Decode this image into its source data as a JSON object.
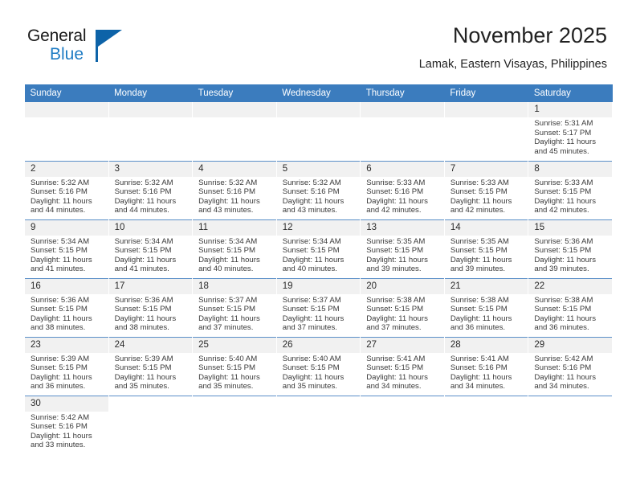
{
  "brand": {
    "name_part1": "General",
    "name_part2": "Blue",
    "accent_color": "#1f7cc4",
    "flag_color": "#0d63a8"
  },
  "header": {
    "month_title": "November 2025",
    "location": "Lamak, Eastern Visayas, Philippines"
  },
  "calendar": {
    "header_color": "#3b7cbe",
    "weekday_headers": [
      "Sunday",
      "Monday",
      "Tuesday",
      "Wednesday",
      "Thursday",
      "Friday",
      "Saturday"
    ],
    "weeks": [
      [
        {
          "day": "",
          "blank": true
        },
        {
          "day": "",
          "blank": true
        },
        {
          "day": "",
          "blank": true
        },
        {
          "day": "",
          "blank": true
        },
        {
          "day": "",
          "blank": true
        },
        {
          "day": "",
          "blank": true
        },
        {
          "day": "1",
          "sunrise": "Sunrise: 5:31 AM",
          "sunset": "Sunset: 5:17 PM",
          "daylight": "Daylight: 11 hours and 45 minutes."
        }
      ],
      [
        {
          "day": "2",
          "sunrise": "Sunrise: 5:32 AM",
          "sunset": "Sunset: 5:16 PM",
          "daylight": "Daylight: 11 hours and 44 minutes."
        },
        {
          "day": "3",
          "sunrise": "Sunrise: 5:32 AM",
          "sunset": "Sunset: 5:16 PM",
          "daylight": "Daylight: 11 hours and 44 minutes."
        },
        {
          "day": "4",
          "sunrise": "Sunrise: 5:32 AM",
          "sunset": "Sunset: 5:16 PM",
          "daylight": "Daylight: 11 hours and 43 minutes."
        },
        {
          "day": "5",
          "sunrise": "Sunrise: 5:32 AM",
          "sunset": "Sunset: 5:16 PM",
          "daylight": "Daylight: 11 hours and 43 minutes."
        },
        {
          "day": "6",
          "sunrise": "Sunrise: 5:33 AM",
          "sunset": "Sunset: 5:16 PM",
          "daylight": "Daylight: 11 hours and 42 minutes."
        },
        {
          "day": "7",
          "sunrise": "Sunrise: 5:33 AM",
          "sunset": "Sunset: 5:15 PM",
          "daylight": "Daylight: 11 hours and 42 minutes."
        },
        {
          "day": "8",
          "sunrise": "Sunrise: 5:33 AM",
          "sunset": "Sunset: 5:15 PM",
          "daylight": "Daylight: 11 hours and 42 minutes."
        }
      ],
      [
        {
          "day": "9",
          "sunrise": "Sunrise: 5:34 AM",
          "sunset": "Sunset: 5:15 PM",
          "daylight": "Daylight: 11 hours and 41 minutes."
        },
        {
          "day": "10",
          "sunrise": "Sunrise: 5:34 AM",
          "sunset": "Sunset: 5:15 PM",
          "daylight": "Daylight: 11 hours and 41 minutes."
        },
        {
          "day": "11",
          "sunrise": "Sunrise: 5:34 AM",
          "sunset": "Sunset: 5:15 PM",
          "daylight": "Daylight: 11 hours and 40 minutes."
        },
        {
          "day": "12",
          "sunrise": "Sunrise: 5:34 AM",
          "sunset": "Sunset: 5:15 PM",
          "daylight": "Daylight: 11 hours and 40 minutes."
        },
        {
          "day": "13",
          "sunrise": "Sunrise: 5:35 AM",
          "sunset": "Sunset: 5:15 PM",
          "daylight": "Daylight: 11 hours and 39 minutes."
        },
        {
          "day": "14",
          "sunrise": "Sunrise: 5:35 AM",
          "sunset": "Sunset: 5:15 PM",
          "daylight": "Daylight: 11 hours and 39 minutes."
        },
        {
          "day": "15",
          "sunrise": "Sunrise: 5:36 AM",
          "sunset": "Sunset: 5:15 PM",
          "daylight": "Daylight: 11 hours and 39 minutes."
        }
      ],
      [
        {
          "day": "16",
          "sunrise": "Sunrise: 5:36 AM",
          "sunset": "Sunset: 5:15 PM",
          "daylight": "Daylight: 11 hours and 38 minutes."
        },
        {
          "day": "17",
          "sunrise": "Sunrise: 5:36 AM",
          "sunset": "Sunset: 5:15 PM",
          "daylight": "Daylight: 11 hours and 38 minutes."
        },
        {
          "day": "18",
          "sunrise": "Sunrise: 5:37 AM",
          "sunset": "Sunset: 5:15 PM",
          "daylight": "Daylight: 11 hours and 37 minutes."
        },
        {
          "day": "19",
          "sunrise": "Sunrise: 5:37 AM",
          "sunset": "Sunset: 5:15 PM",
          "daylight": "Daylight: 11 hours and 37 minutes."
        },
        {
          "day": "20",
          "sunrise": "Sunrise: 5:38 AM",
          "sunset": "Sunset: 5:15 PM",
          "daylight": "Daylight: 11 hours and 37 minutes."
        },
        {
          "day": "21",
          "sunrise": "Sunrise: 5:38 AM",
          "sunset": "Sunset: 5:15 PM",
          "daylight": "Daylight: 11 hours and 36 minutes."
        },
        {
          "day": "22",
          "sunrise": "Sunrise: 5:38 AM",
          "sunset": "Sunset: 5:15 PM",
          "daylight": "Daylight: 11 hours and 36 minutes."
        }
      ],
      [
        {
          "day": "23",
          "sunrise": "Sunrise: 5:39 AM",
          "sunset": "Sunset: 5:15 PM",
          "daylight": "Daylight: 11 hours and 36 minutes."
        },
        {
          "day": "24",
          "sunrise": "Sunrise: 5:39 AM",
          "sunset": "Sunset: 5:15 PM",
          "daylight": "Daylight: 11 hours and 35 minutes."
        },
        {
          "day": "25",
          "sunrise": "Sunrise: 5:40 AM",
          "sunset": "Sunset: 5:15 PM",
          "daylight": "Daylight: 11 hours and 35 minutes."
        },
        {
          "day": "26",
          "sunrise": "Sunrise: 5:40 AM",
          "sunset": "Sunset: 5:15 PM",
          "daylight": "Daylight: 11 hours and 35 minutes."
        },
        {
          "day": "27",
          "sunrise": "Sunrise: 5:41 AM",
          "sunset": "Sunset: 5:15 PM",
          "daylight": "Daylight: 11 hours and 34 minutes."
        },
        {
          "day": "28",
          "sunrise": "Sunrise: 5:41 AM",
          "sunset": "Sunset: 5:16 PM",
          "daylight": "Daylight: 11 hours and 34 minutes."
        },
        {
          "day": "29",
          "sunrise": "Sunrise: 5:42 AM",
          "sunset": "Sunset: 5:16 PM",
          "daylight": "Daylight: 11 hours and 34 minutes."
        }
      ],
      [
        {
          "day": "30",
          "sunrise": "Sunrise: 5:42 AM",
          "sunset": "Sunset: 5:16 PM",
          "daylight": "Daylight: 11 hours and 33 minutes."
        },
        {
          "day": "",
          "blank": true,
          "hidden": true
        },
        {
          "day": "",
          "blank": true,
          "hidden": true
        },
        {
          "day": "",
          "blank": true,
          "hidden": true
        },
        {
          "day": "",
          "blank": true,
          "hidden": true
        },
        {
          "day": "",
          "blank": true,
          "hidden": true
        },
        {
          "day": "",
          "blank": true,
          "hidden": true
        }
      ]
    ]
  }
}
